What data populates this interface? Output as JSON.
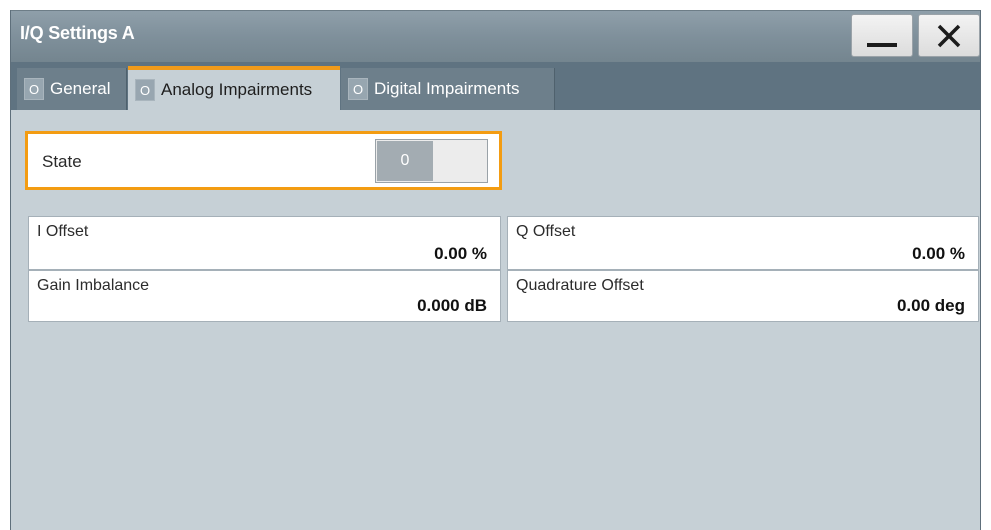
{
  "window": {
    "title": "I/Q Settings A"
  },
  "tabs": [
    {
      "indicator": "O",
      "label": "General"
    },
    {
      "indicator": "O",
      "label": "Analog Impairments"
    },
    {
      "indicator": "O",
      "label": "Digital Impairments"
    }
  ],
  "active_tab": "Analog Impairments",
  "state": {
    "label": "State",
    "toggle_value": "0"
  },
  "fields": {
    "i_offset": {
      "label": "I Offset",
      "value": "0.00 %"
    },
    "q_offset": {
      "label": "Q Offset",
      "value": "0.00 %"
    },
    "gain_imbalance": {
      "label": "Gain Imbalance",
      "value": "0.000 dB"
    },
    "quadrature_offset": {
      "label": "Quadrature Offset",
      "value": "0.00 deg"
    }
  },
  "colors": {
    "accent": "#f39c12",
    "titlebar": "#7f909b",
    "tabbar": "#5f7381",
    "panel": "#c6d0d6"
  },
  "icons": {
    "minimize": "minimize-icon",
    "close": "close-icon"
  }
}
